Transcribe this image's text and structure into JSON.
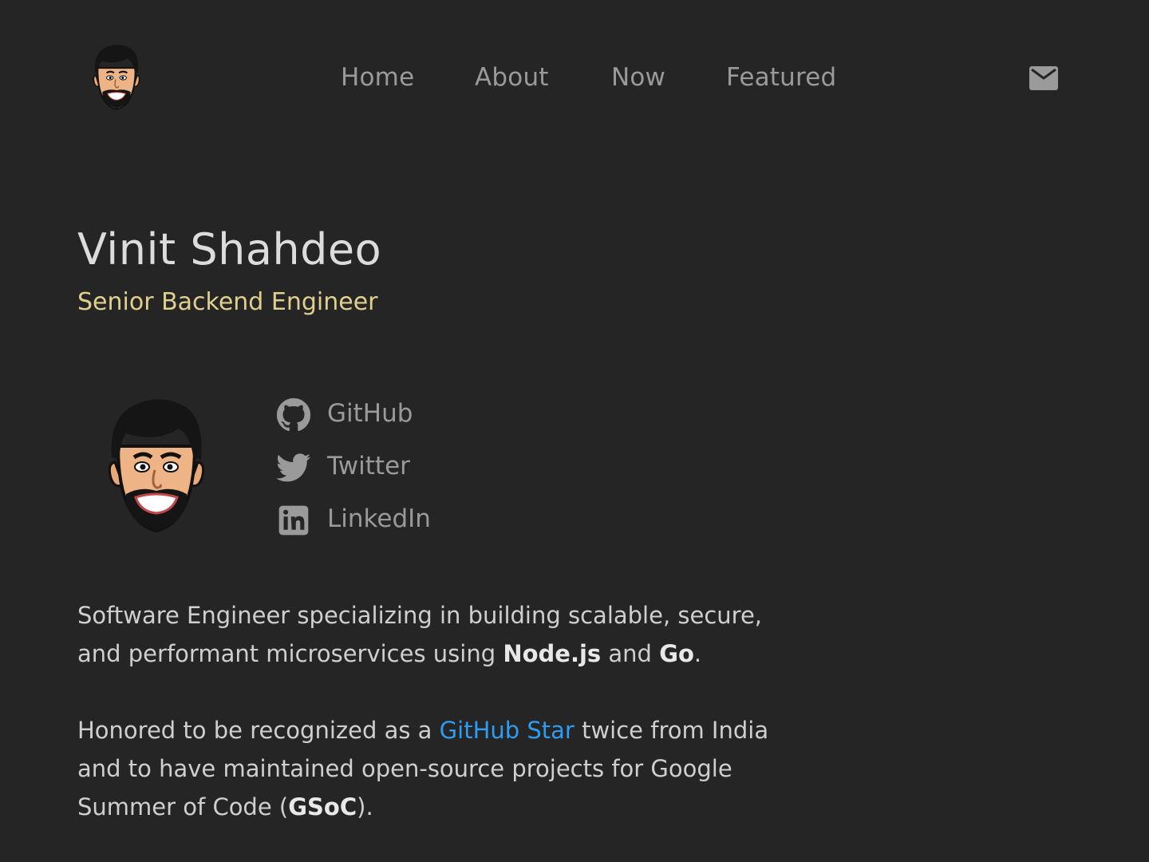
{
  "header": {
    "logo_icon": "avatar-caricature-icon",
    "nav": [
      {
        "label": "Home"
      },
      {
        "label": "About"
      },
      {
        "label": "Now"
      },
      {
        "label": "Featured"
      }
    ],
    "mail_icon": "mail-icon"
  },
  "hero": {
    "name": "Vinit Shahdeo",
    "title": "Senior Backend Engineer",
    "avatar_icon": "avatar-caricature-icon"
  },
  "social": [
    {
      "label": "GitHub",
      "icon": "github-icon"
    },
    {
      "label": "Twitter",
      "icon": "twitter-icon"
    },
    {
      "label": "LinkedIn",
      "icon": "linkedin-icon"
    }
  ],
  "bio": {
    "p1": {
      "t1": "Software Engineer specializing in building scalable, secure, and performant microservices using ",
      "b1": "Node.js",
      "t2": " and ",
      "b2": "Go",
      "t3": "."
    },
    "p2": {
      "t1": "Honored to be recognized as a ",
      "link": "GitHub Star",
      "t2": " twice from India and to have maintained open-source projects for Google Summer of Code (",
      "b1": "GSoC",
      "t3": ")."
    }
  },
  "colors": {
    "background": "#252525",
    "nav_text": "#9a9a9a",
    "heading": "#dcdcdc",
    "subtitle_accent": "#e1cf8e",
    "body_text": "#cfcfcf",
    "link": "#2e9cf0"
  }
}
